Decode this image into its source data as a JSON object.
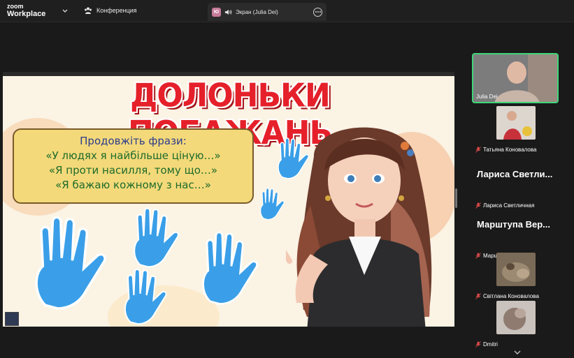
{
  "app": {
    "brand_line1": "zoom",
    "brand_line2": "Workplace"
  },
  "header": {
    "conference_label": "Конференция",
    "share_tab": {
      "badge": "Ю",
      "label": "Экран (Julia Dei)"
    }
  },
  "slide": {
    "title": "ДОЛОНЬКИ ПОБАЖАНЬ",
    "heading": "Продовжіть фрази:",
    "lines": [
      "«У людях я найбільше ціную…»",
      "«Я проти насилля, тому що…»",
      "«Я бажаю кожному з нас…»"
    ],
    "colors": {
      "title": "#e5202a",
      "hands": "#3a9fe8",
      "box": "#f3d979"
    }
  },
  "participants": [
    {
      "name": "Julia Dei",
      "active": true,
      "video": true,
      "muted": false
    },
    {
      "name": "Татьяна Коновалова",
      "video": true,
      "muted": true
    },
    {
      "display": "Лариса  Светли...",
      "name": "Лариса Светличная",
      "video": false,
      "muted": true
    },
    {
      "display": "Марштупа  Вер...",
      "name": "Марштупа Вероніка",
      "video": false,
      "muted": true
    },
    {
      "name": "Світлана Коновалова",
      "video": true,
      "muted": true
    },
    {
      "name": "Dmitri",
      "video": true,
      "muted": true
    }
  ],
  "icons": {
    "brand_menu": "chevron-down-icon",
    "conference": "participants-icon",
    "more": "more-options-icon",
    "audio": "speaker-icon",
    "muted": "mic-muted-icon"
  }
}
